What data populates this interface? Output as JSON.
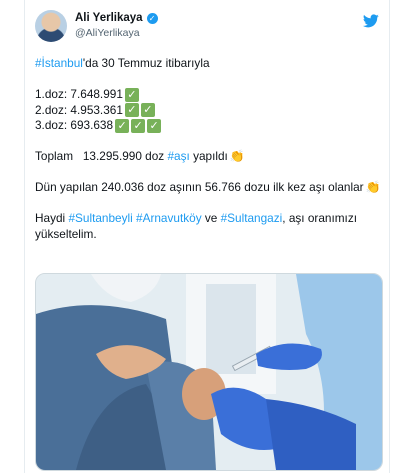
{
  "author": {
    "name": "Ali Yerlikaya",
    "handle": "@AliYerlikaya"
  },
  "tweet": {
    "line1_tag": "#İstanbul",
    "line1_rest": "'da 30 Temmuz itibarıyla",
    "dose1": "1.doz: 7.648.991",
    "dose2": "2.doz: 4.953.361",
    "dose3": "3.doz: 693.638",
    "total_prefix": "Toplam   13.295.990 doz ",
    "total_tag": "#aşı",
    "total_suffix": " yapıldı",
    "yesterday": "Dün yapılan 240.036 doz aşının 56.766 dozu ilk kez aşı olanlar",
    "call_prefix": "Haydi ",
    "call_tag1": "#Sultanbeyli",
    "call_tag2": "#Arnavutköy",
    "call_and": " ve ",
    "call_tag3": "#Sultangazi",
    "call_suffix": ", aşı oranımızı yükseltelim."
  },
  "icons": {
    "verified": "verified-badge-icon",
    "bird": "twitter-bird-icon",
    "check": "white-check-mark-icon",
    "clap": "clapping-hands-icon"
  },
  "colors": {
    "link": "#1d9bf0",
    "check_green": "#78b159",
    "glove_blue": "#3a6fd8"
  }
}
